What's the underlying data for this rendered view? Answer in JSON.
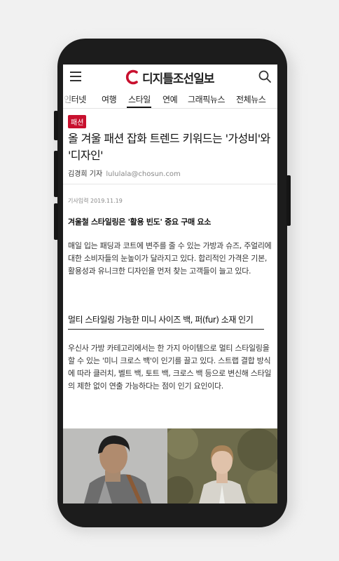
{
  "header": {
    "logo_text": "디지틀조선일보",
    "menu_icon": "hamburger-icon",
    "search_icon": "search-icon"
  },
  "tabs": [
    {
      "label": "인터넷"
    },
    {
      "label": "여행"
    },
    {
      "label": "스타일"
    },
    {
      "label": "연예"
    },
    {
      "label": "그래픽뉴스"
    },
    {
      "label": "전체뉴스"
    }
  ],
  "active_tab": "스타일",
  "article": {
    "category": "패션",
    "headline": "올 겨울 패션 잡화 트렌드 키워드는 '가성비'와 '디자인'",
    "author": "김경희 기자",
    "email": "lululala@chosun.com",
    "date": "기사입력 2019.11.19",
    "subheading1": "겨울철 스타일링은 '활용 빈도' 중요 구매 요소",
    "paragraph1": "매일 입는 패딩과 코트에 변주를 줄 수 있는 가방과 슈즈, 주얼리에 대한 소비자들의 눈높이가 달라지고 있다. 합리적인 가격은 기본, 활용성과 유니크한 디자인을 먼저 찾는 고객들이 늘고 있다.",
    "subheading2": "멀티 스타일링 가능한 미니 사이즈 백, 퍼(fur) 소재 인기",
    "paragraph2": "우신사 가방 카테고리에서는 한 가지 아이템으로 멀티 스타일링을 할 수 있는 '미니 크로스 백'이 인기를 끌고 있다. 스트랩 결합 방식에 따라 클러치, 벨트 백, 토트 백, 크로스 백 등으로 변신해 스타일의 제한 없이 연출 가능하다는 점이 인기 요인이다."
  },
  "colors": {
    "brand_red": "#c8102e",
    "text": "#111111",
    "muted": "#888888"
  }
}
